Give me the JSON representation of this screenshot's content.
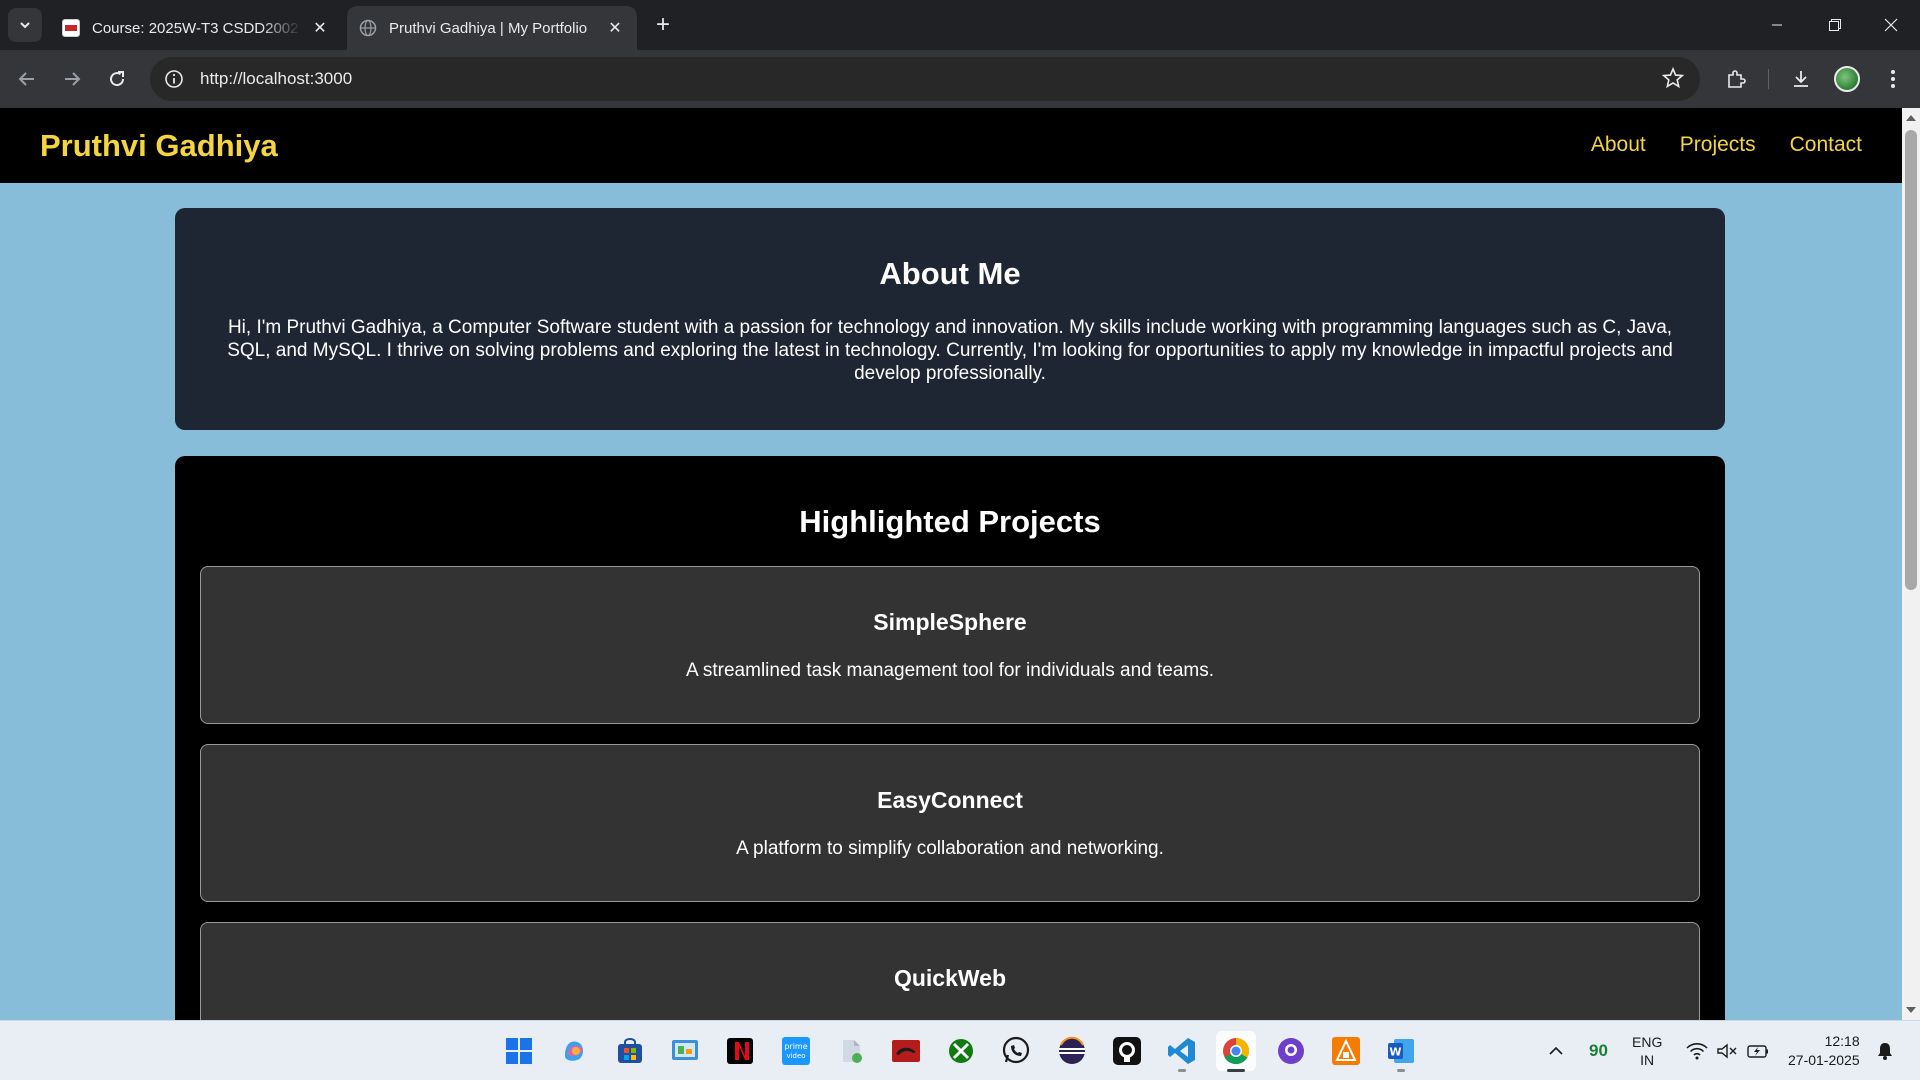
{
  "browser": {
    "tabs": [
      {
        "title": "Course: 2025W-T3 CSDD2002 -",
        "active": false,
        "favicon": "course-favicon"
      },
      {
        "title": "Pruthvi Gadhiya | My Portfolio",
        "active": true,
        "favicon": "globe-icon"
      }
    ],
    "url": "http://localhost:3000"
  },
  "site": {
    "brand": "Pruthvi Gadhiya",
    "nav": [
      "About",
      "Projects",
      "Contact"
    ],
    "accent": "#f5d442"
  },
  "about": {
    "heading": "About Me",
    "text": "Hi, I'm Pruthvi Gadhiya, a Computer Software student with a passion for technology and innovation. My skills include working with programming languages such as C, Java, SQL, and MySQL. I thrive on solving problems and exploring the latest in technology. Currently, I'm looking for opportunities to apply my knowledge in impactful projects and develop professionally."
  },
  "projects": {
    "heading": "Highlighted Projects",
    "items": [
      {
        "title": "SimpleSphere",
        "description": "A streamlined task management tool for individuals and teams."
      },
      {
        "title": "EasyConnect",
        "description": "A platform to simplify collaboration and networking."
      },
      {
        "title": "QuickWeb",
        "description": ""
      }
    ]
  },
  "taskbar": {
    "apps": [
      "start",
      "copilot",
      "microsoft-store",
      "control-panel",
      "netflix",
      "prime-video",
      "files",
      "red-app",
      "xbox",
      "whatsapp",
      "eclipse",
      "github",
      "vscode",
      "chrome",
      "github-desktop",
      "sourcetree",
      "word"
    ],
    "tray_number": "90",
    "language": "ENG",
    "region": "IN",
    "time": "12:18",
    "date": "27-01-2025"
  }
}
